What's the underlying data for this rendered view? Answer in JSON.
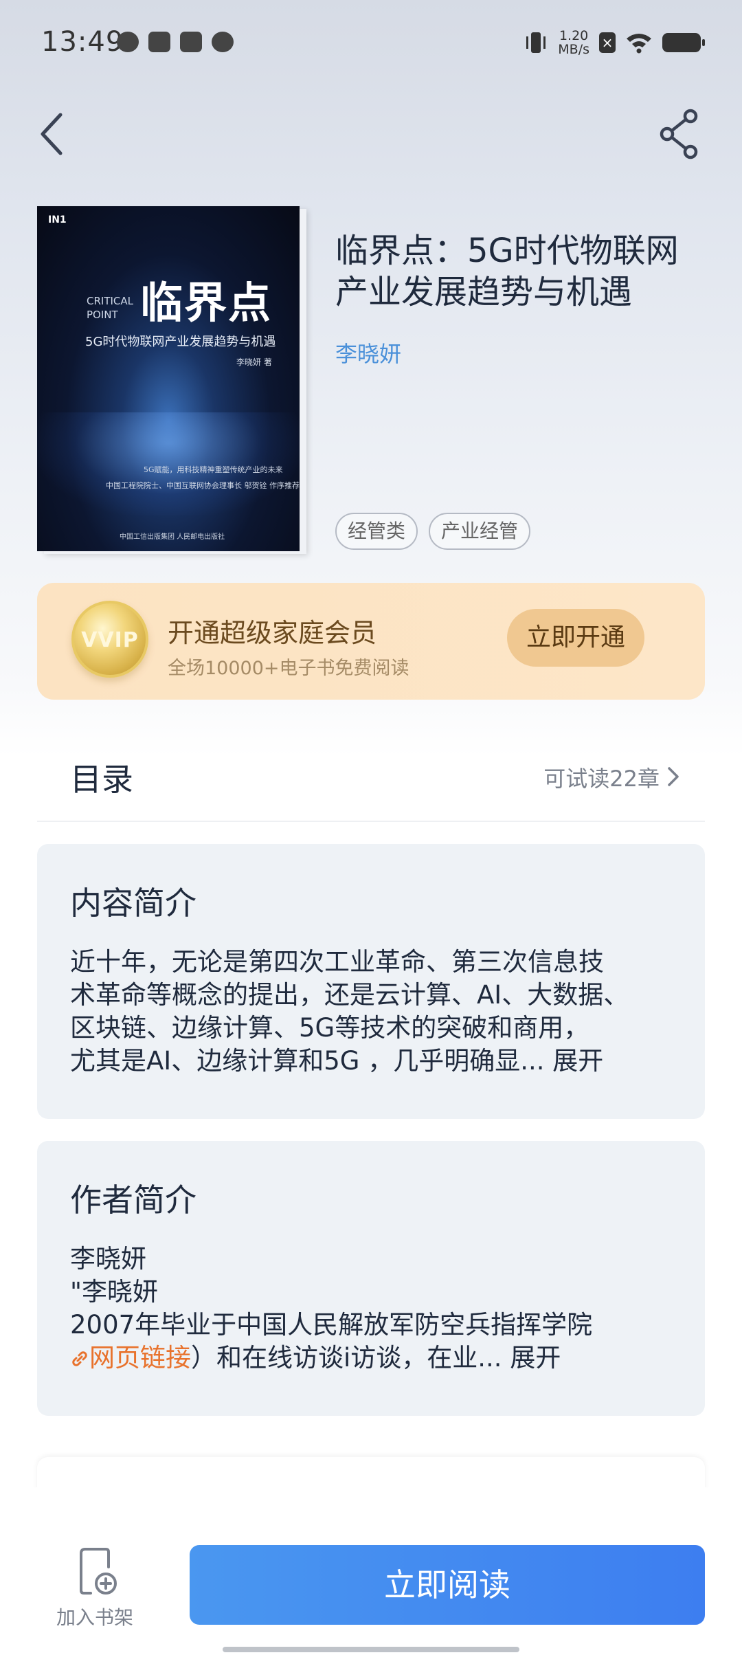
{
  "status_bar": {
    "time": "13:49",
    "net_speed_value": "1.20",
    "net_speed_unit": "MB/s"
  },
  "book": {
    "title": "临界点：5G时代物联网产业发展趋势与机遇",
    "author": "李晓妍",
    "tags": [
      "经管类",
      "产业经管"
    ],
    "cover": {
      "title": "临界点",
      "title_en": "CRITICAL POINT",
      "subtitle": "5G时代物联网产业发展趋势与机遇",
      "author": "李晓妍 著",
      "blurb1": "5G赋能，用科技精神重塑传统产业的未来",
      "blurb2": "中国工程院院士、中国互联网协会理事长 邬贺铨 作序推荐",
      "publisher": "中国工信出版集团  人民邮电出版社"
    }
  },
  "vip": {
    "title": "开通超级家庭会员",
    "subtitle": "全场10000+电子书免费阅读",
    "button": "立即开通",
    "coin_text": "VVIP"
  },
  "catalog": {
    "label": "目录",
    "trial": "可试读22章"
  },
  "intro": {
    "title": "内容简介",
    "lines": [
      "近十年，无论是第四次工业革命、第三次信息技",
      "术革命等概念的提出，还是云计算、AI、大数据、",
      "区块链、边缘计算、5G等技术的突破和商用，",
      "尤其是AI、边缘计算和5G ，几乎明确显..."
    ],
    "expand": "展开"
  },
  "author_intro": {
    "title": "作者简介",
    "lines": [
      "李晓妍",
      "\"李晓妍",
      "2007年毕业于中国人民解放军防空兵指挥学院"
    ],
    "link_text": "网页链接",
    "after_link": "）和在线访谈i访谈，在业...",
    "expand": "展开"
  },
  "bottom": {
    "shelf_label": "加入书架",
    "read_button": "立即阅读"
  },
  "colors": {
    "accent_blue": "#4a90d9",
    "vip_bg": "#fce3c2",
    "link_orange": "#e8722c"
  }
}
